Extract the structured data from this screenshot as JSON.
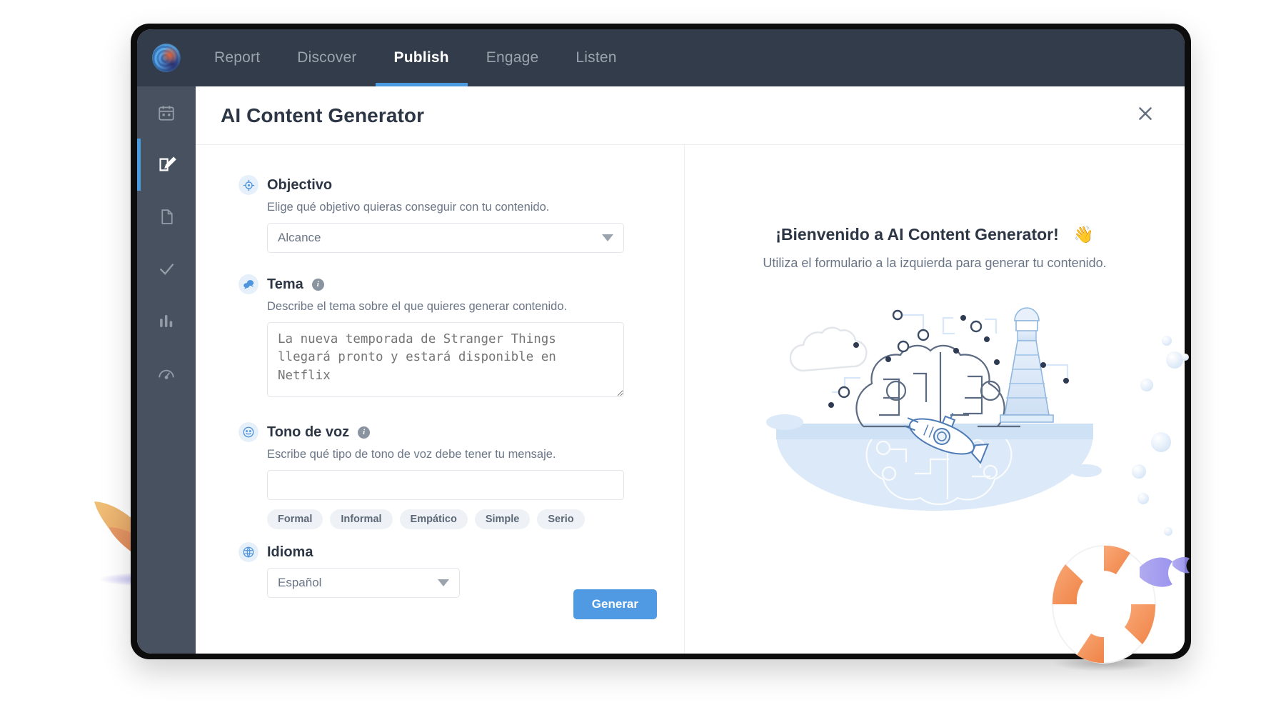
{
  "app": {
    "logo_icon": "spiral-logo-icon",
    "nav": [
      {
        "label": "Report",
        "active": false
      },
      {
        "label": "Discover",
        "active": false
      },
      {
        "label": "Publish",
        "active": true
      },
      {
        "label": "Engage",
        "active": false
      },
      {
        "label": "Listen",
        "active": false
      }
    ]
  },
  "sidebar": {
    "items": [
      {
        "icon": "calendar-icon",
        "active": false
      },
      {
        "icon": "compose-icon",
        "active": true
      },
      {
        "icon": "document-icon",
        "active": false
      },
      {
        "icon": "check-icon",
        "active": false
      },
      {
        "icon": "bar-chart-icon",
        "active": false
      },
      {
        "icon": "speedometer-icon",
        "active": false
      }
    ]
  },
  "modal": {
    "title": "AI Content Generator",
    "close_icon": "close-icon"
  },
  "form": {
    "objetivo": {
      "icon": "target-icon",
      "label": "Objectivo",
      "help": "Elige qué objetivo quieras conseguir con tu contenido.",
      "selected": "Alcance"
    },
    "tema": {
      "icon": "chat-bubbles-icon",
      "label": "Tema",
      "info_icon": "info-icon",
      "help": "Describe el tema sobre el que quieres generar contenido.",
      "placeholder": "La nueva temporada de Stranger Things llegará pronto y estará disponible en Netflix",
      "value": ""
    },
    "tono": {
      "icon": "smiley-icon",
      "label": "Tono de voz",
      "info_icon": "info-icon",
      "help": "Escribe qué tipo de tono de voz debe tener tu mensaje.",
      "value": "",
      "placeholder": "",
      "chips": [
        "Formal",
        "Informal",
        "Empático",
        "Simple",
        "Serio"
      ]
    },
    "idioma": {
      "icon": "globe-icon",
      "label": "Idioma",
      "selected": "Español"
    },
    "submit_label": "Generar"
  },
  "preview": {
    "title": "¡Bienvenido a AI Content Generator!",
    "title_emoji": "👋",
    "subtitle": "Utiliza el formulario a la izquierda para generar tu contenido.",
    "illustration": "brain-submarine-lighthouse-illustration"
  },
  "decorations": {
    "plant": "orange-seaweed-plant",
    "life_ring": "life-ring-float",
    "fish": "purple-fish",
    "bubbles": "water-bubbles"
  },
  "colors": {
    "accent": "#4f9ae3",
    "nav_bg": "#333c4a",
    "sidebar_bg": "#48515f",
    "text_dark": "#2d3645",
    "text_muted": "#6a7586",
    "chip_bg": "#eef1f5"
  }
}
